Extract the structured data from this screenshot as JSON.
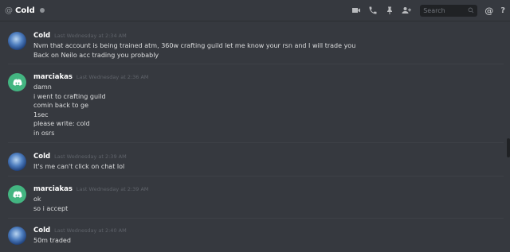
{
  "header": {
    "at_symbol": "@",
    "dm_name": "Cold",
    "search_placeholder": "Search",
    "mention_symbol": "@",
    "help_symbol": "?"
  },
  "messages": [
    {
      "author": "Cold",
      "avatar": "cold-avatar",
      "timestamp": "Last Wednesday at 2:34 AM",
      "lines": [
        "Nvm that account is being trained atm, 360w crafting guild let me know your rsn and I will trade you",
        "Back on Neilo acc trading you probably"
      ]
    },
    {
      "author": "marciakas",
      "avatar": "discord-avatar",
      "timestamp": "Last Wednesday at 2:36 AM",
      "lines": [
        "damn",
        "i went to crafting guild",
        "comin back to ge",
        "1sec",
        "please write: cold",
        "in osrs"
      ]
    },
    {
      "author": "Cold",
      "avatar": "cold-avatar",
      "timestamp": "Last Wednesday at 2:39 AM",
      "lines": [
        "It's me can't click on chat lol"
      ]
    },
    {
      "author": "marciakas",
      "avatar": "discord-avatar",
      "timestamp": "Last Wednesday at 2:39 AM",
      "lines": [
        "ok",
        "so i accept"
      ]
    },
    {
      "author": "Cold",
      "avatar": "cold-avatar",
      "timestamp": "Last Wednesday at 2:40 AM",
      "lines": [
        "50m traded"
      ]
    }
  ]
}
